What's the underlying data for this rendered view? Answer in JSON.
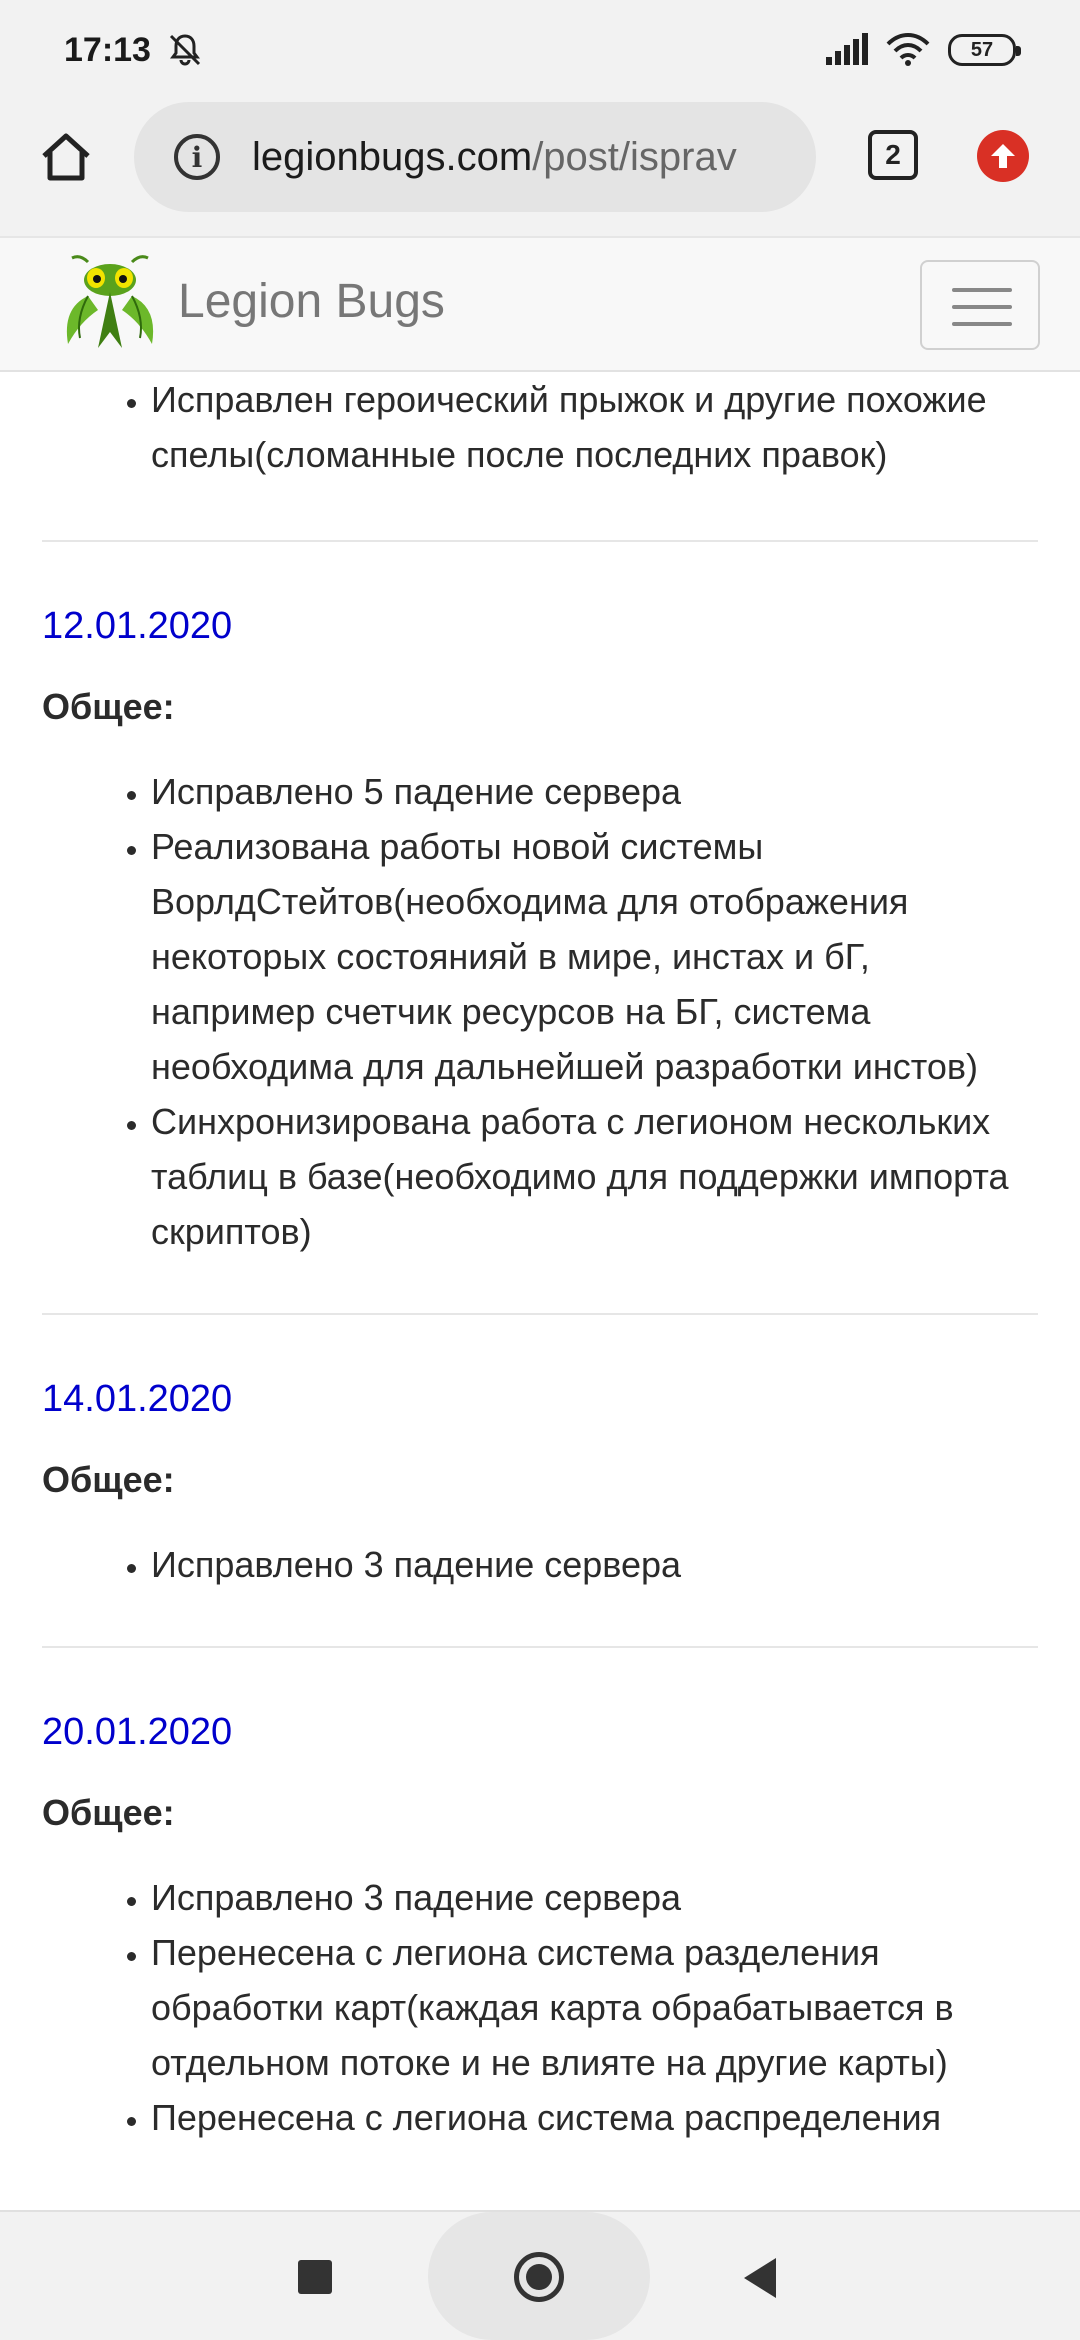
{
  "status_bar": {
    "time": "17:13",
    "battery": "57",
    "icons": [
      "mute-bell-icon",
      "signal-icon",
      "wifi-icon",
      "battery-icon"
    ]
  },
  "browser": {
    "url_domain": "legionbugs.com",
    "url_path": "/post/isprav",
    "tab_count": "2",
    "icons": [
      "home-icon",
      "info-icon",
      "tabs-icon",
      "update-icon"
    ]
  },
  "site": {
    "brand": "Legion Bugs",
    "icons": [
      "mantis-logo",
      "hamburger-menu-icon"
    ]
  },
  "entries": [
    {
      "items": [
        "Исправлен героический прыжок и другие похожие спелы(сломанные после последних правок)"
      ]
    },
    {
      "date": "12.01.2020",
      "section": "Общее:",
      "items": [
        "Исправлено 5 падение сервера",
        "Реализована работы новой системы ВорлдСтейтов(необходима для отображения некоторых состоянияй в мире, инстах и бГ, например счетчик ресурсов на БГ, система необходима для дальнейшей разработки инстов)",
        "Синхронизирована работа с легионом нескольких таблиц в базе(необходимо для поддержки импорта скриптов)"
      ]
    },
    {
      "date": "14.01.2020",
      "section": "Общее:",
      "items": [
        "Исправлено 3 падение сервера"
      ]
    },
    {
      "date": "20.01.2020",
      "section": "Общее:",
      "items": [
        "Исправлено 3 падение сервера",
        "Перенесена с легиона система разделения обработки карт(каждая карта обрабатывается в отдельном потоке и не влияте на другие карты)",
        "Перенесена с легиона система распределения"
      ]
    }
  ],
  "navigation": {
    "icons": [
      "recents-square-icon",
      "home-circle-icon",
      "back-triangle-icon"
    ]
  },
  "colors": {
    "date_link": "#0000cc",
    "update_badge": "#d93025",
    "logo_green": "#5aa21c"
  }
}
